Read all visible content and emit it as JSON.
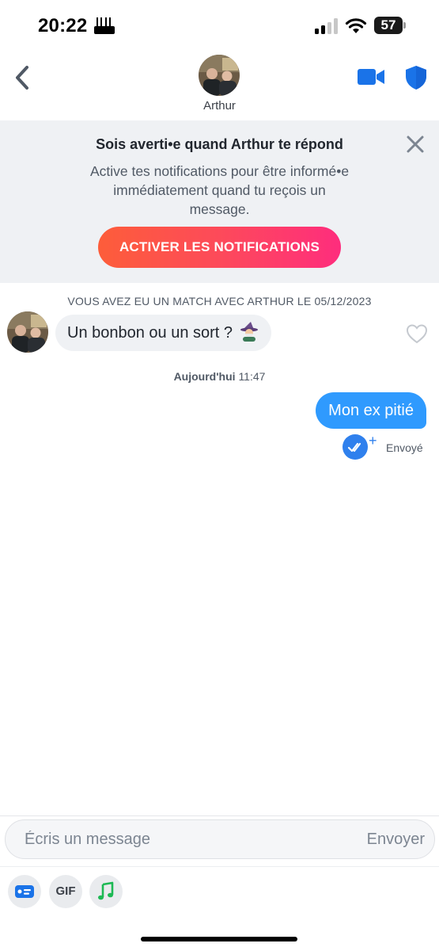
{
  "status_bar": {
    "time": "20:22",
    "battery": "57"
  },
  "header": {
    "contact_name": "Arthur",
    "back_icon": "chevron-left-icon",
    "video_icon": "video-camera-icon",
    "safety_icon": "shield-icon"
  },
  "notification_banner": {
    "title": "Sois averti•e quand Arthur te répond",
    "body": "Active tes notifications pour être informé•e immédiatement quand tu reçois un message.",
    "button_label": "ACTIVER LES NOTIFICATIONS",
    "close_icon": "close-icon"
  },
  "chat": {
    "match_text": "VOUS AVEZ EU UN MATCH AVEC ARTHUR LE 05/12/2023",
    "incoming_message": "Un bonbon ou un sort ?",
    "incoming_emoji": "wizard-emoji",
    "date_label_bold": "Aujourd'hui",
    "date_label_time": "11:47",
    "outgoing_message": "Mon ex pitié",
    "sent_status": "Envoyé",
    "read_plus": "+"
  },
  "composer": {
    "placeholder": "Écris un message",
    "send_label": "Envoyer",
    "gif_label": "GIF"
  },
  "colors": {
    "brand_gradient_start": "#fd5d3a",
    "brand_gradient_end": "#fe2d7d",
    "outgoing_bubble": "#2f9afe",
    "accent_blue": "#2f80ed",
    "banner_bg": "#eff1f4"
  }
}
